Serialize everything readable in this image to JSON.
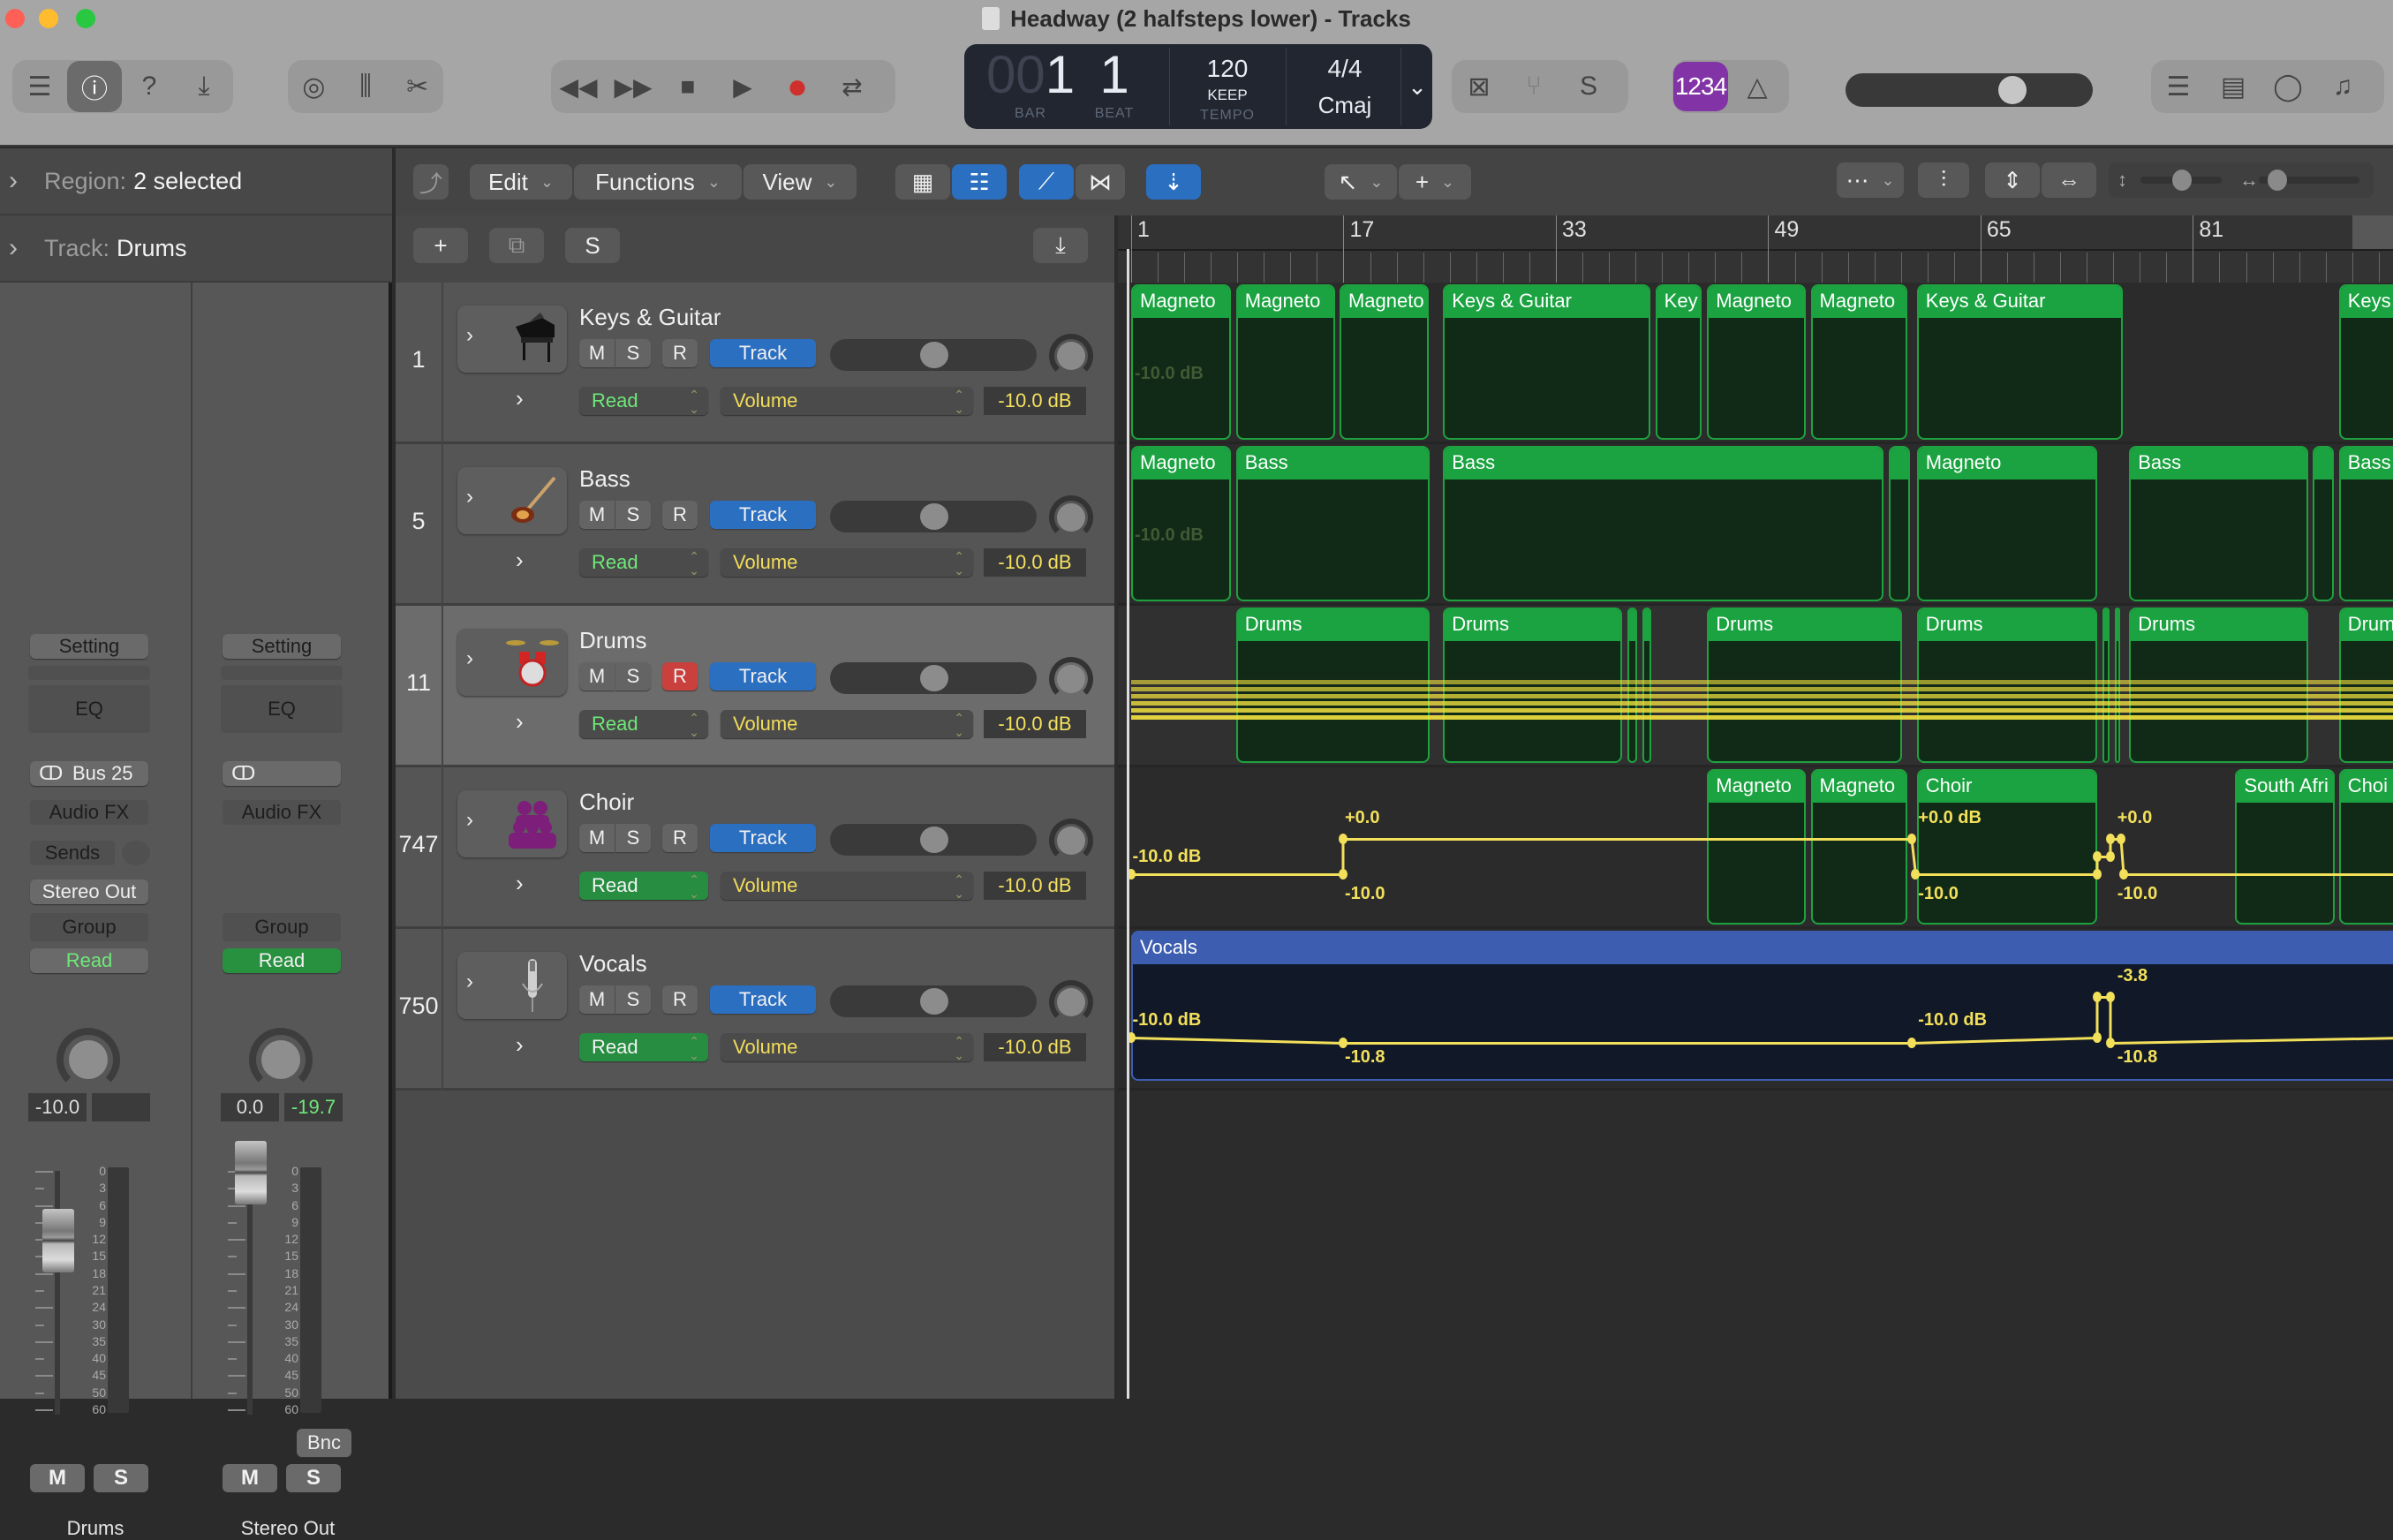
{
  "window": {
    "title": "Headway (2 halfsteps lower) - Tracks",
    "traffic_lights": [
      "#fe5f57",
      "#febc2e",
      "#28c840"
    ]
  },
  "toolbar": {
    "left_group": [
      {
        "name": "library-icon",
        "glyph": "☰",
        "active": false
      },
      {
        "name": "inspector-icon",
        "glyph": "ⓘ",
        "active": true
      },
      {
        "name": "quick-help-icon",
        "glyph": "?",
        "active": false
      },
      {
        "name": "toolbar-icon",
        "glyph": "⤓",
        "active": false
      }
    ],
    "edit_group": [
      {
        "name": "smart-controls-icon",
        "glyph": "◎"
      },
      {
        "name": "mixer-icon",
        "glyph": "⫼"
      },
      {
        "name": "editors-icon",
        "glyph": "✂"
      }
    ],
    "transport": [
      {
        "name": "rewind-icon",
        "glyph": "◀◀"
      },
      {
        "name": "fast-forward-icon",
        "glyph": "▶▶"
      },
      {
        "name": "stop-icon",
        "glyph": "■"
      },
      {
        "name": "play-icon",
        "glyph": "▶"
      },
      {
        "name": "record-icon",
        "glyph": "●"
      },
      {
        "name": "cycle-icon",
        "glyph": "⇄"
      }
    ],
    "lcd": {
      "bar_dim": "00",
      "bar": "1",
      "beat": "1",
      "bar_label": "BAR",
      "beat_label": "BEAT",
      "tempo": "120",
      "tempo_mode": "KEEP",
      "tempo_label": "TEMPO",
      "time_signature": "4/4",
      "key": "Cmaj",
      "menu_glyph": "⌄"
    },
    "mode_group": [
      {
        "name": "replace-icon",
        "glyph": "⊠"
      },
      {
        "name": "tuner-icon",
        "glyph": "⑂"
      },
      {
        "name": "solo-icon",
        "glyph": "S"
      }
    ],
    "count_in": "1234",
    "metronome_glyph": "△",
    "master_volume_fraction": 0.72,
    "right_group": [
      {
        "name": "list-editors-icon",
        "glyph": "☰"
      },
      {
        "name": "notepad-icon",
        "glyph": "▤"
      },
      {
        "name": "loop-browser-icon",
        "glyph": "◯"
      },
      {
        "name": "browsers-icon",
        "glyph": "♫"
      }
    ]
  },
  "inspector": {
    "region_label": "Region:",
    "region_value": "2 selected",
    "track_label": "Track:",
    "track_value": "Drums",
    "strips": [
      {
        "setting": "Setting",
        "eq": "EQ",
        "input_glyph": "ↀ",
        "input": "Bus 25",
        "audio_fx": "Audio FX",
        "sends": "Sends",
        "output": "Stereo Out",
        "group": "Group",
        "automation": "Read",
        "automation_on": false,
        "volume": "-10.0",
        "peak": "",
        "fader_db": -10.0,
        "mute": "M",
        "solo": "S",
        "name": "Drums"
      },
      {
        "setting": "Setting",
        "eq": "EQ",
        "input_glyph": "ↀ",
        "input": "",
        "audio_fx": "Audio FX",
        "sends": "",
        "output": "",
        "group": "Group",
        "automation": "Read",
        "automation_on": true,
        "volume": "0.0",
        "peak": "-19.7",
        "fader_db": 0.0,
        "bounce": "Bnc",
        "mute": "M",
        "solo": "S",
        "name": "Stereo Out"
      }
    ],
    "meter_scale": [
      "0",
      "3",
      "6",
      "9",
      "12",
      "15",
      "18",
      "21",
      "24",
      "30",
      "35",
      "40",
      "45",
      "50",
      "60"
    ]
  },
  "tracks_toolbar": {
    "back_glyph": "⤴",
    "menus": [
      "Edit",
      "Functions",
      "View"
    ],
    "view_grid_glyph": "▦",
    "view_list_glyph": "☷",
    "automation_glyph": "⟋",
    "flex_glyph": "⋈",
    "snap_glyph": "⇣",
    "pointer_tool_glyph": "↖",
    "pencil_tool_glyph": "+",
    "catch_glyph": "⋯",
    "waveform_glyph": "⫶",
    "zoom_v_glyph": "⇕",
    "zoom_h_glyph": "⇔",
    "vertical_zoom_fraction": 0.45,
    "horizontal_zoom_fraction": 0.1
  },
  "headers_bar": {
    "add_glyph": "+",
    "duplicate_glyph": "⧉",
    "solo_glyph": "S",
    "catch_glyph": "⤓"
  },
  "tracks": [
    {
      "number": "1",
      "name": "Keys & Guitar",
      "icon": "piano",
      "mute": "M",
      "solo": "S",
      "record": "R",
      "record_armed": false,
      "track_button": "Track",
      "pan_fraction": 0.5,
      "automation_mode": "Read",
      "automation_on": false,
      "parameter": "Volume",
      "value": "-10.0 dB",
      "selected": false
    },
    {
      "number": "5",
      "name": "Bass",
      "icon": "bass-guitar",
      "mute": "M",
      "solo": "S",
      "record": "R",
      "record_armed": false,
      "track_button": "Track",
      "pan_fraction": 0.5,
      "automation_mode": "Read",
      "automation_on": false,
      "parameter": "Volume",
      "value": "-10.0 dB",
      "selected": false
    },
    {
      "number": "11",
      "name": "Drums",
      "icon": "drum-kit",
      "mute": "M",
      "solo": "S",
      "record": "R",
      "record_armed": true,
      "track_button": "Track",
      "pan_fraction": 0.5,
      "automation_mode": "Read",
      "automation_on": false,
      "parameter": "Volume",
      "value": "-10.0 dB",
      "selected": true
    },
    {
      "number": "747",
      "name": "Choir",
      "icon": "choir",
      "mute": "M",
      "solo": "S",
      "record": "R",
      "record_armed": false,
      "track_button": "Track",
      "pan_fraction": 0.5,
      "automation_mode": "Read",
      "automation_on": true,
      "parameter": "Volume",
      "value": "-10.0 dB",
      "selected": false
    },
    {
      "number": "750",
      "name": "Vocals",
      "icon": "microphone",
      "mute": "M",
      "solo": "S",
      "record": "R",
      "record_armed": false,
      "track_button": "Track",
      "pan_fraction": 0.5,
      "automation_mode": "Read",
      "automation_on": true,
      "parameter": "Volume",
      "value": "-10.0 dB",
      "selected": false
    }
  ],
  "ruler": {
    "bars": [
      "1",
      "17",
      "33",
      "49",
      "65",
      "81"
    ],
    "bar_numbers": [
      1,
      17,
      33,
      49,
      65,
      81
    ],
    "visible_bars": [
      1,
      96
    ]
  },
  "regions": [
    [
      {
        "label": "Magneto",
        "start": 1,
        "length": 7.7
      },
      {
        "label": "Magneto",
        "start": 8.9,
        "length": 7.7
      },
      {
        "label": "Magneto",
        "start": 16.7,
        "length": 6.9
      },
      {
        "label": "Keys & Guitar",
        "start": 24.5,
        "length": 15.8
      },
      {
        "label": "Key",
        "start": 40.5,
        "length": 3.7
      },
      {
        "label": "Magneto",
        "start": 44.4,
        "length": 7.6
      },
      {
        "label": "Magneto",
        "start": 52.2,
        "length": 7.5
      },
      {
        "label": "Keys & Guitar",
        "start": 60.2,
        "length": 15.7
      },
      {
        "label": "Keys",
        "start": 92.0,
        "length": 5
      }
    ],
    [
      {
        "label": "Magneto",
        "start": 1,
        "length": 7.7
      },
      {
        "label": "Bass",
        "start": 8.9,
        "length": 14.8
      },
      {
        "label": "Bass",
        "start": 24.5,
        "length": 33.4
      },
      {
        "label": "",
        "start": 58.1,
        "length": 1.8
      },
      {
        "label": "Magneto",
        "start": 60.2,
        "length": 13.8
      },
      {
        "label": "Bass",
        "start": 76.2,
        "length": 13.7
      },
      {
        "label": "",
        "start": 90.0,
        "length": 1.8
      },
      {
        "label": "Bass",
        "start": 92.0,
        "length": 5
      }
    ],
    [
      {
        "label": "Drums",
        "start": 8.9,
        "length": 14.8
      },
      {
        "label": "Drums",
        "start": 24.5,
        "length": 13.7
      },
      {
        "label": "",
        "start": 38.4,
        "length": 0.9
      },
      {
        "label": "",
        "start": 39.5,
        "length": 0.9
      },
      {
        "label": "Drums",
        "start": 44.4,
        "length": 14.9
      },
      {
        "label": "Drums",
        "start": 60.2,
        "length": 13.8
      },
      {
        "label": "",
        "start": 74.2,
        "length": 0.7
      },
      {
        "label": "",
        "start": 75.1,
        "length": 0.6
      },
      {
        "label": "Drums",
        "start": 76.2,
        "length": 13.7
      },
      {
        "label": "Drums",
        "start": 92.0,
        "length": 5
      }
    ],
    [
      {
        "label": "Magneto",
        "start": 44.4,
        "length": 7.6
      },
      {
        "label": "Magneto",
        "start": 52.2,
        "length": 7.5
      },
      {
        "label": "Choir",
        "start": 60.2,
        "length": 13.8
      },
      {
        "label": "South Afri",
        "start": 84.2,
        "length": 7.7
      },
      {
        "label": "Choi",
        "start": 92.0,
        "length": 5
      }
    ],
    [
      {
        "label": "Vocals",
        "start": 1,
        "length": 96,
        "color": "blue"
      }
    ]
  ],
  "automation": {
    "keys_label": "-10.0 dB",
    "bass_label": "-10.0 dB",
    "choir": {
      "labels": [
        {
          "text": "-10.0 dB",
          "bar": 1.1,
          "pos": "above-low"
        },
        {
          "text": "+0.0",
          "bar": 17.1,
          "pos": "above-high"
        },
        {
          "text": "-10.0",
          "bar": 17.1,
          "pos": "below-low"
        },
        {
          "text": "+0.0 dB",
          "bar": 60.3,
          "pos": "above-high"
        },
        {
          "text": "-10.0",
          "bar": 60.3,
          "pos": "below-low"
        },
        {
          "text": "+0.0",
          "bar": 75.3,
          "pos": "above-high"
        },
        {
          "text": "-10.0",
          "bar": 75.3,
          "pos": "below-low"
        }
      ],
      "points": [
        [
          1,
          -10
        ],
        [
          17,
          -10
        ],
        [
          17,
          0
        ],
        [
          59.8,
          0
        ],
        [
          60.1,
          -10
        ],
        [
          73.8,
          -10
        ],
        [
          73.8,
          -5
        ],
        [
          74.8,
          -5
        ],
        [
          74.8,
          0
        ],
        [
          75.6,
          0
        ],
        [
          75.8,
          -10
        ],
        [
          97,
          -10
        ]
      ]
    },
    "vocals": {
      "labels": [
        {
          "text": "-10.0 dB",
          "bar": 1.1,
          "pos": "above"
        },
        {
          "text": "-10.8",
          "bar": 17.1,
          "pos": "below"
        },
        {
          "text": "-10.0 dB",
          "bar": 60.3,
          "pos": "above"
        },
        {
          "text": "-3.8",
          "bar": 75.3,
          "pos": "above-high"
        },
        {
          "text": "-10.8",
          "bar": 75.3,
          "pos": "below"
        }
      ],
      "points": [
        [
          1,
          -10
        ],
        [
          17,
          -10.8
        ],
        [
          59.8,
          -10.8
        ],
        [
          73.8,
          -10
        ],
        [
          73.8,
          -3.8
        ],
        [
          74.8,
          -3.8
        ],
        [
          74.8,
          -10.8
        ],
        [
          97,
          -10
        ]
      ]
    }
  }
}
